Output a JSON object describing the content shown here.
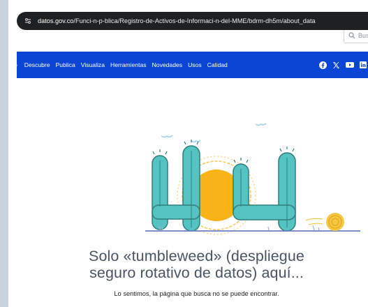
{
  "browser": {
    "url_host": "datos.gov.co",
    "url_path": "/Funci-n-p-blica/Registro-de-Activos-de-Informaci-n-del-MME/bdrm-dh5m/about_data"
  },
  "search": {
    "placeholder": "Busca"
  },
  "nav": {
    "items": [
      "o",
      "Descubre",
      "Publica",
      "Visualiza",
      "Herramientas",
      "Novedades",
      "Usos",
      "Calidad"
    ]
  },
  "social": [
    "facebook-icon",
    "x-icon",
    "youtube-icon",
    "linkedin-icon"
  ],
  "error": {
    "illustration_text": "404",
    "headline_line1": "Solo «tumbleweed» (despliegue",
    "headline_line2": "seguro rotativo de datos) aquí...",
    "message": "Lo sentimos, la página que busca no se puede encontrar."
  },
  "colors": {
    "nav_bg": "#0a45d6",
    "cactus": "#55c3c2",
    "sun": "#f7b318",
    "tumbleweed": "#f5c842"
  }
}
